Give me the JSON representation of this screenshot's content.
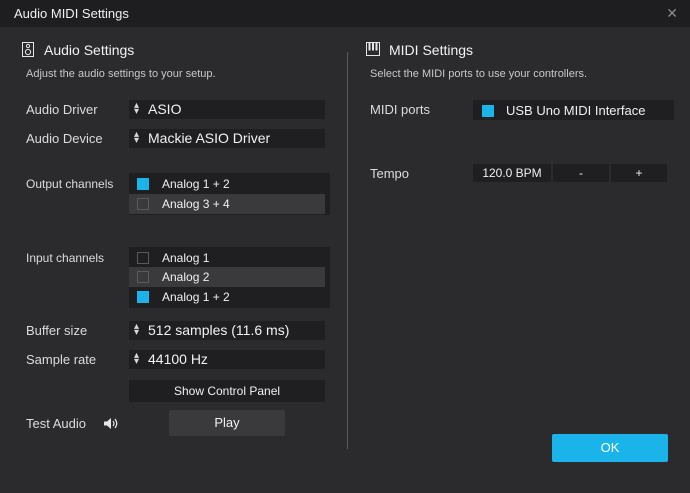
{
  "window": {
    "title": "Audio MIDI Settings"
  },
  "audio": {
    "title": "Audio Settings",
    "description": "Adjust the audio settings to your setup.",
    "driver_label": "Audio Driver",
    "driver_value": "ASIO",
    "device_label": "Audio Device",
    "device_value": "Mackie ASIO Driver",
    "output_label": "Output channels",
    "output_channels": [
      {
        "label": "Analog 1 + 2",
        "checked": true
      },
      {
        "label": "Analog 3 + 4",
        "checked": false
      }
    ],
    "input_label": "Input channels",
    "input_channels": [
      {
        "label": "Analog 1",
        "checked": false
      },
      {
        "label": "Analog 2",
        "checked": false
      },
      {
        "label": "Analog 1 + 2",
        "checked": true
      }
    ],
    "buffer_label": "Buffer size",
    "buffer_value": "512 samples (11.6 ms)",
    "rate_label": "Sample rate",
    "rate_value": "44100 Hz",
    "control_panel_label": "Show Control Panel",
    "test_label": "Test Audio",
    "play_label": "Play"
  },
  "midi": {
    "title": "MIDI Settings",
    "description": "Select the MIDI ports to use your controllers.",
    "ports_label": "MIDI ports",
    "ports": [
      {
        "label": "USB Uno MIDI Interface",
        "checked": true
      }
    ],
    "tempo_label": "Tempo",
    "tempo_value": "120.0 BPM",
    "tempo_minus": "-",
    "tempo_plus": "+"
  },
  "ok_label": "OK",
  "colors": {
    "accent": "#1ab3ea",
    "background": "#2b2b2d",
    "field": "#1f1f21",
    "titlebar": "#1e1e20"
  },
  "icons": {
    "close": "close-icon",
    "speaker": "speaker-icon",
    "speaker_volume": "speaker-volume-icon",
    "piano": "piano-icon",
    "chevron": "up-down-chevron-icon"
  }
}
